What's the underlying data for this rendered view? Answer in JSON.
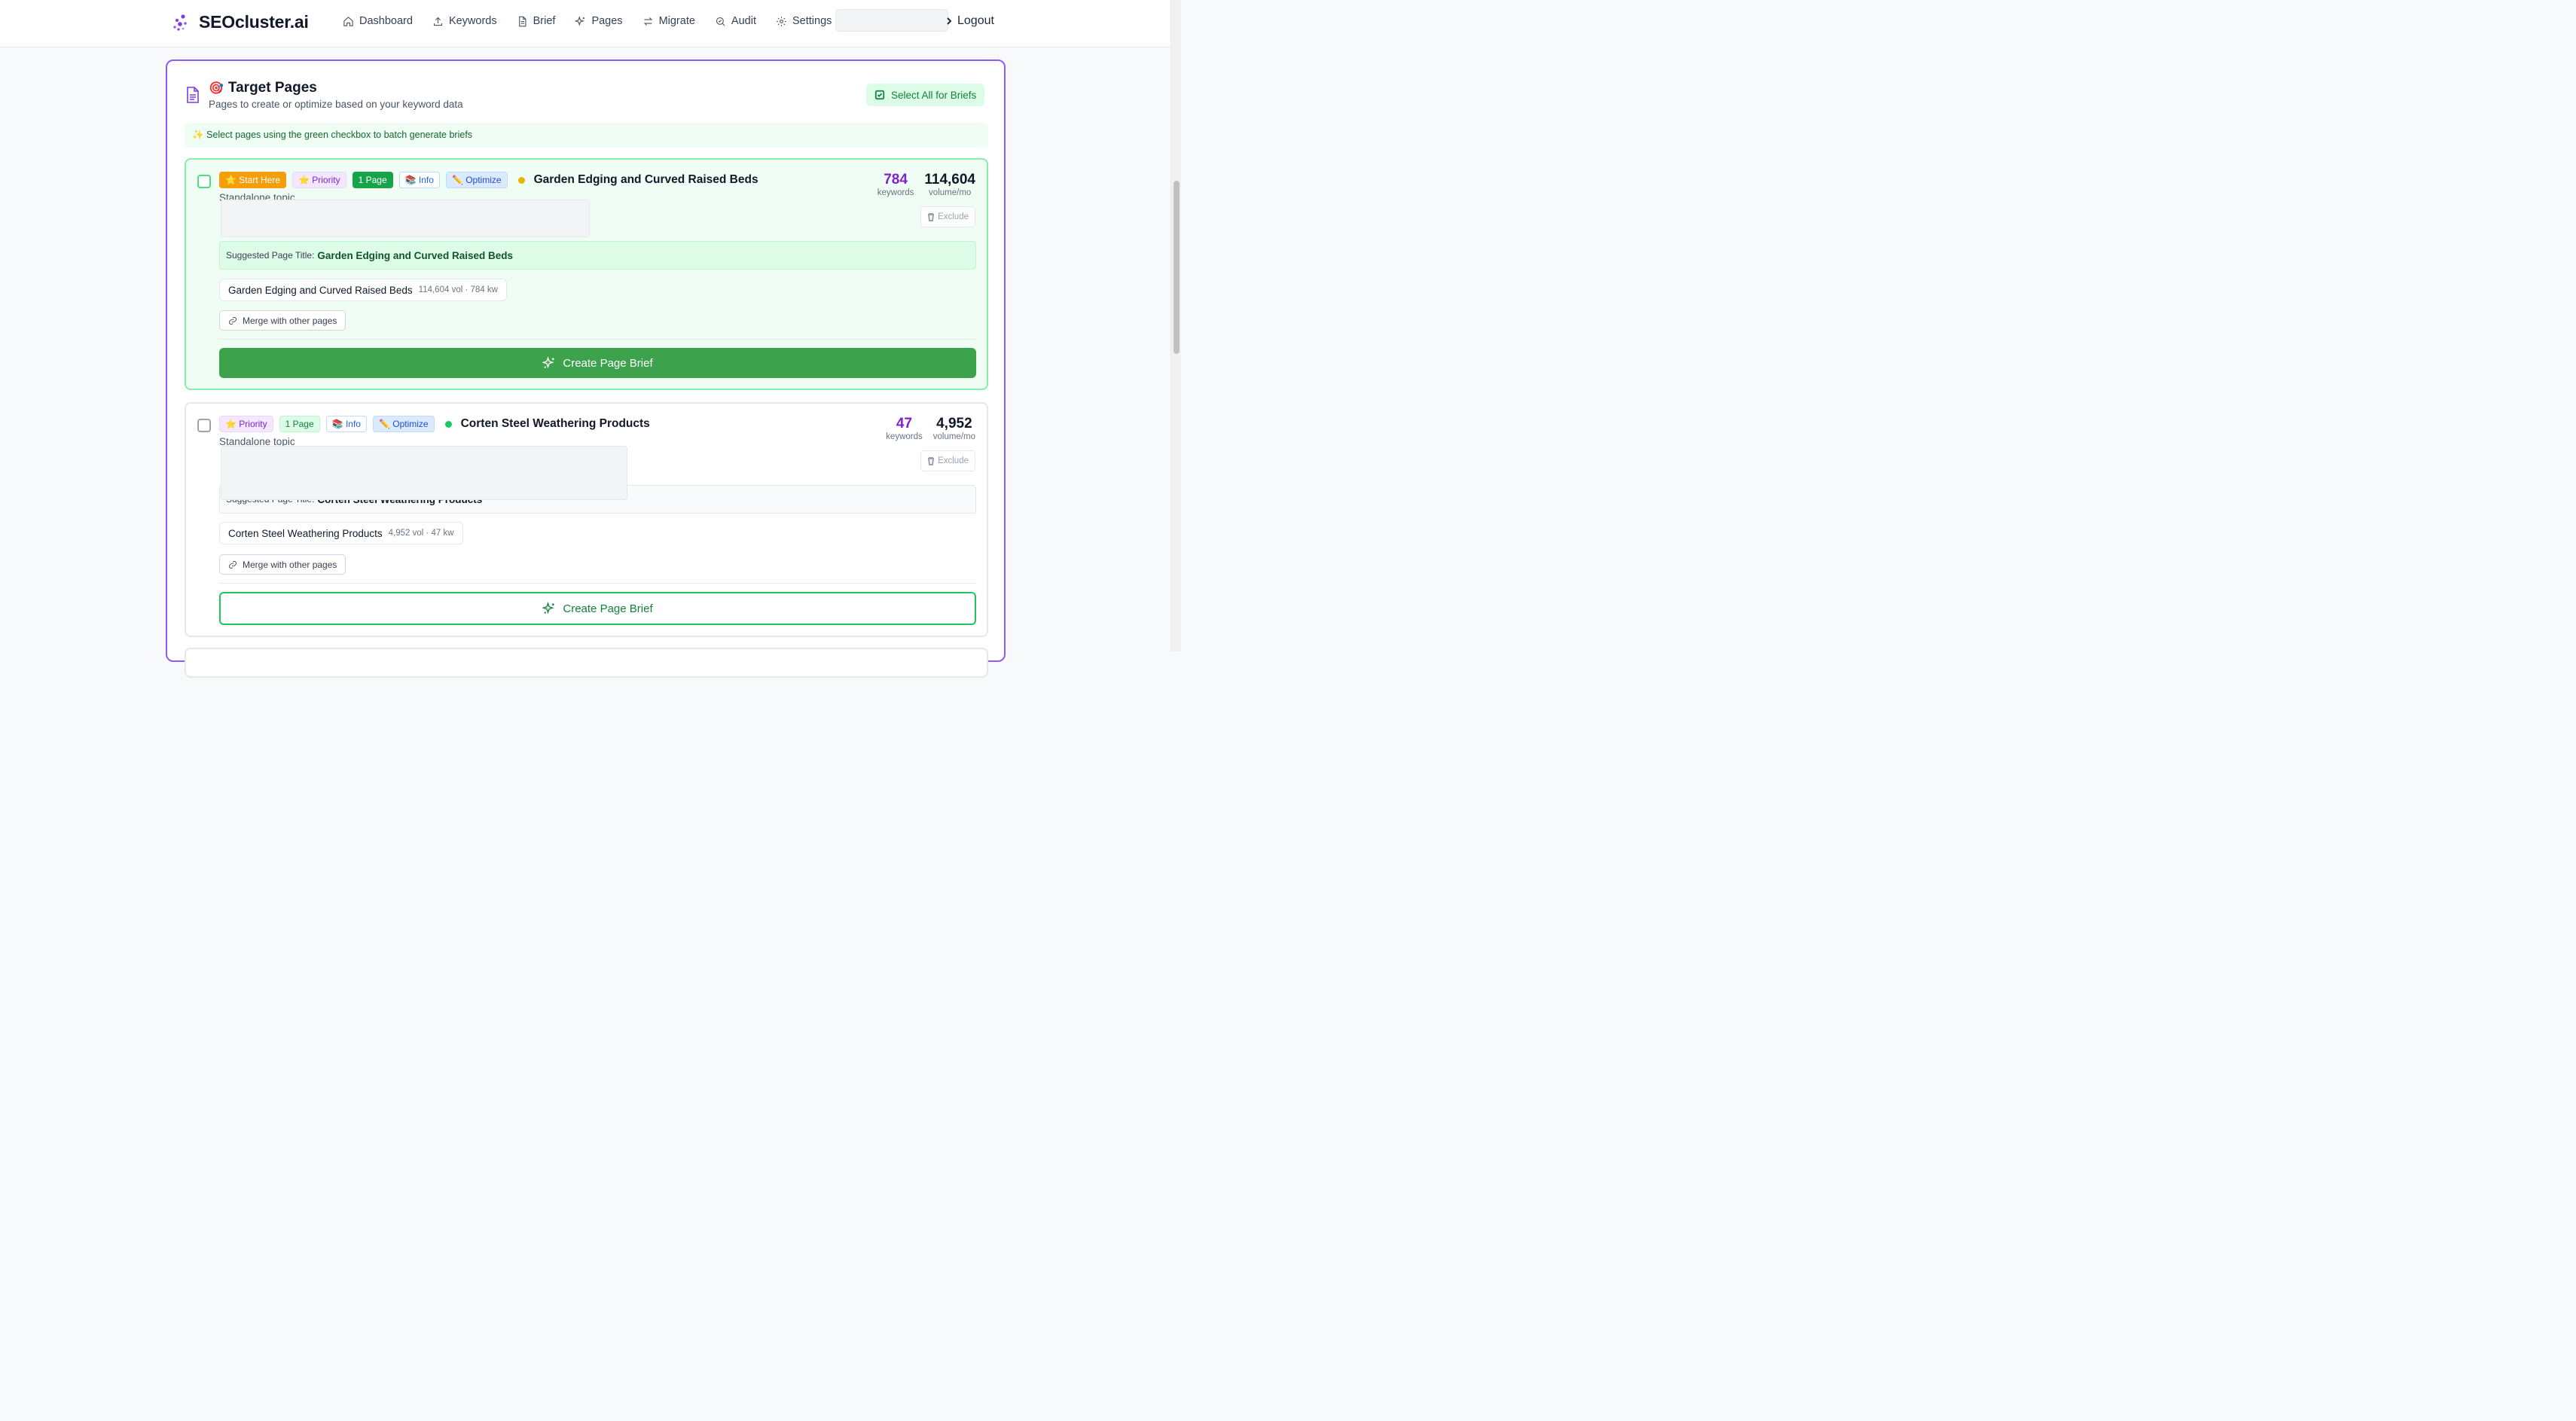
{
  "header": {
    "brand": "SEOcluster.ai",
    "nav": [
      {
        "label": "Dashboard",
        "icon": "home-icon"
      },
      {
        "label": "Keywords",
        "icon": "upload-icon"
      },
      {
        "label": "Brief",
        "icon": "document-icon"
      },
      {
        "label": "Pages",
        "icon": "sparkles-icon"
      },
      {
        "label": "Migrate",
        "icon": "arrows-icon"
      },
      {
        "label": "Audit",
        "icon": "search-check-icon"
      },
      {
        "label": "Settings",
        "icon": "gear-icon"
      }
    ],
    "logout": "Logout"
  },
  "panel": {
    "emoji": "🎯",
    "title": "Target Pages",
    "subtitle": "Pages to create or optimize based on your keyword data",
    "select_all": "Select All for Briefs",
    "hint": "✨ Select pages using the green checkbox to batch generate briefs"
  },
  "cards": [
    {
      "badges": {
        "start": "⭐ Start Here",
        "priority": "⭐ Priority",
        "page": "1 Page",
        "info": "📚 Info",
        "optimize": "✏️ Optimize"
      },
      "dot_color": "#eab308",
      "title": "Garden Edging and Curved Raised Beds",
      "topic": "Standalone topic",
      "keywords": "784",
      "keywords_label": "keywords",
      "volume": "114,604",
      "volume_label": "volume/mo",
      "exclude": "Exclude",
      "suggested_label": "Suggested Page Title:",
      "suggested_value": "Garden Edging and Curved Raised Beds",
      "chip_name": "Garden Edging and Curved Raised Beds",
      "chip_meta": "114,604 vol · 784 kw",
      "merge": "Merge with other pages",
      "create": "Create Page Brief"
    },
    {
      "badges": {
        "priority": "⭐ Priority",
        "page": "1 Page",
        "info": "📚 Info",
        "optimize": "✏️ Optimize"
      },
      "dot_color": "#22c55e",
      "title": "Corten Steel Weathering Products",
      "topic": "Standalone topic",
      "keywords": "47",
      "keywords_label": "keywords",
      "volume": "4,952",
      "volume_label": "volume/mo",
      "exclude": "Exclude",
      "suggested_label": "Suggested Page Title:",
      "suggested_value": "Corten Steel Weathering Products",
      "chip_name": "Corten Steel Weathering Products",
      "chip_meta": "4,952 vol · 47 kw",
      "merge": "Merge with other pages",
      "create": "Create Page Brief"
    }
  ]
}
